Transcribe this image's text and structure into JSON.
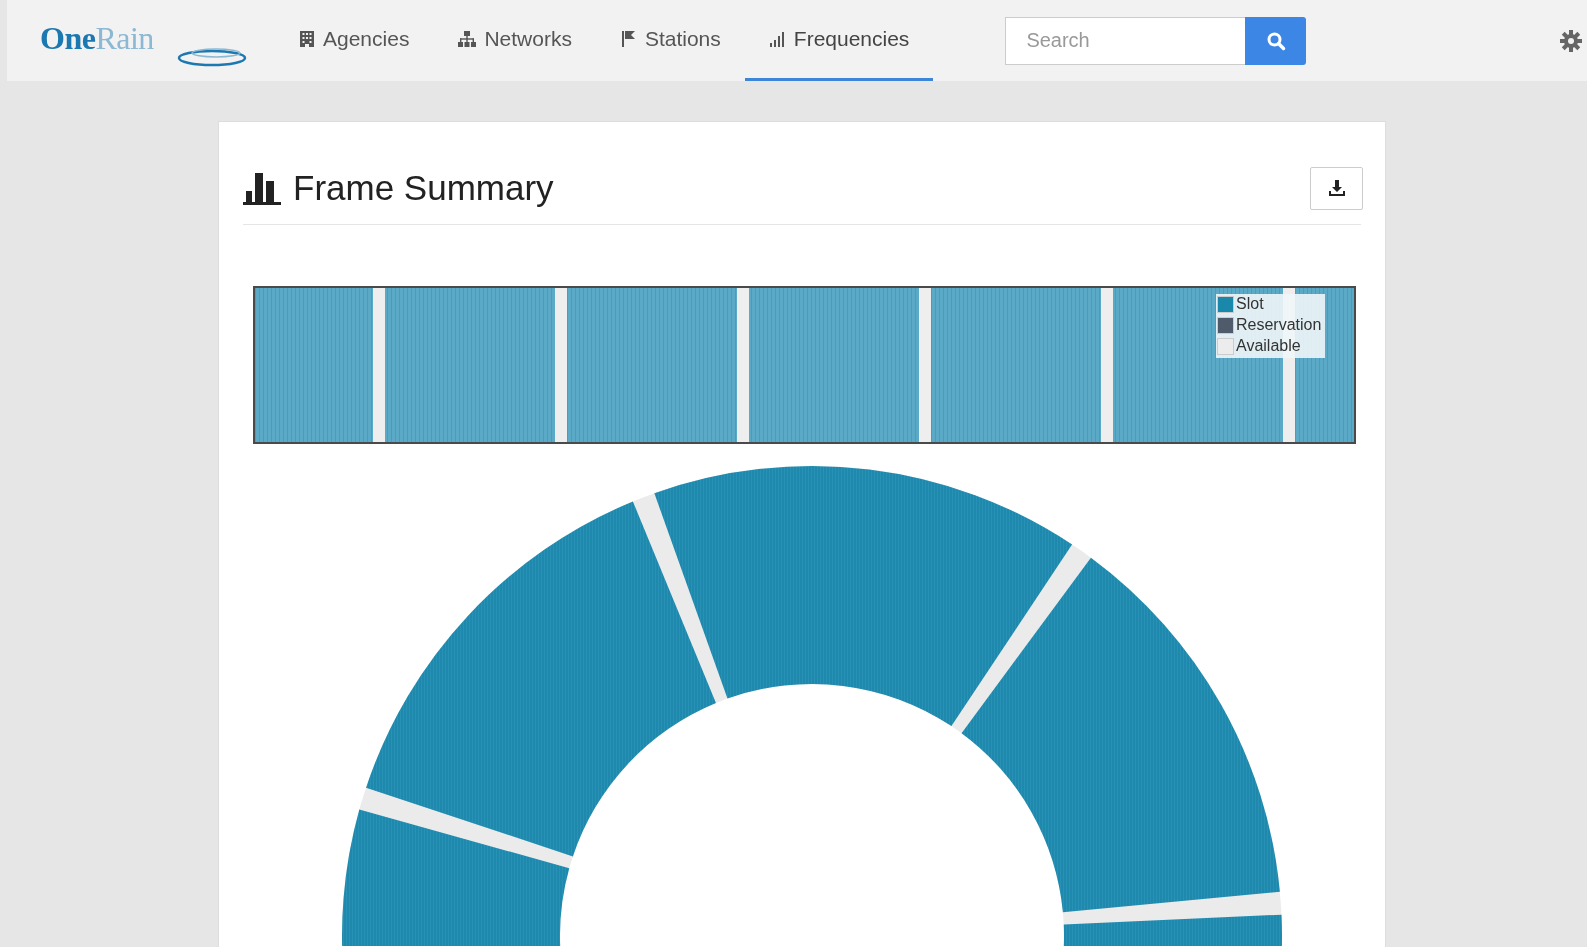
{
  "logo": {
    "first": "One",
    "second": "Rain"
  },
  "nav_tabs": [
    {
      "kind": "building",
      "label": "Agencies",
      "selected": false
    },
    {
      "kind": "sitemap",
      "label": "Networks",
      "selected": false
    },
    {
      "kind": "flag",
      "label": "Stations",
      "selected": false
    },
    {
      "kind": "signal",
      "label": "Frequencies",
      "selected": true
    }
  ],
  "search": {
    "placeholder": "Search"
  },
  "card": {
    "title": "Frame Summary",
    "legend": [
      {
        "label": "Slot",
        "color": "#1a88aa"
      },
      {
        "label": "Reservation",
        "color": "#4f5a6b"
      },
      {
        "label": "Available",
        "color": "#ececec"
      }
    ]
  }
}
